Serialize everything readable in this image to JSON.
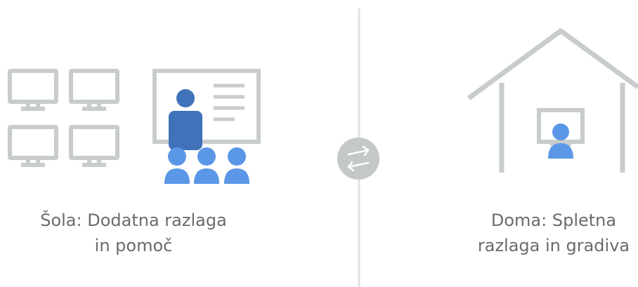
{
  "school": {
    "caption_line1": "Šola: Dodatna razlaga",
    "caption_line2": "in pomoč",
    "icons": [
      "computer-grid-icon",
      "teacher-presentation-icon",
      "students-icon"
    ]
  },
  "home": {
    "caption_line1": "Doma: Spletna",
    "caption_line2": "razlaga in gradiva",
    "icons": [
      "house-icon",
      "student-at-screen-icon"
    ]
  },
  "exchange": {
    "icon": "swap-arrows-icon"
  },
  "colors": {
    "outline_gray": "#c8cccc",
    "divider_gray": "#e0e0e0",
    "teacher_blue": "#3f72b8",
    "student_blue": "#5a97e6",
    "caption_gray": "#6b6b6b",
    "circle_gray": "#c4c8c8"
  }
}
